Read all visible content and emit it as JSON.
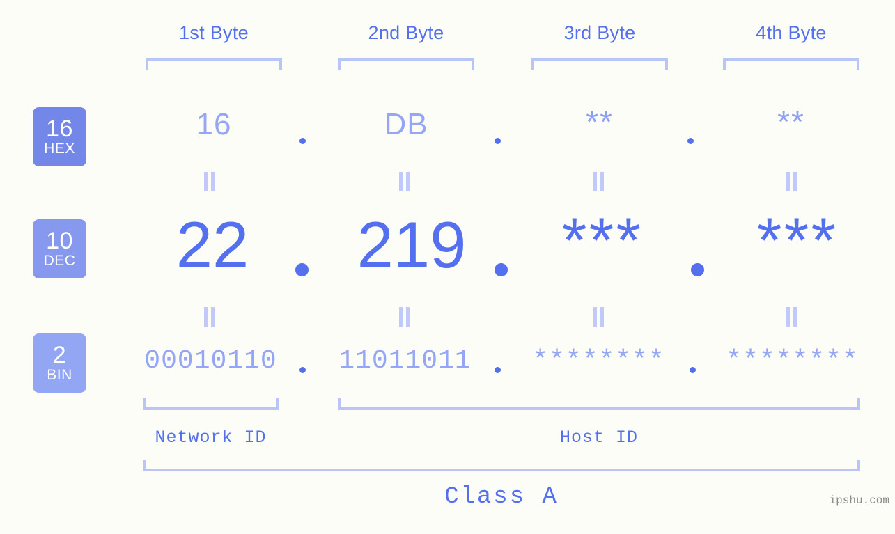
{
  "background_color": "#fbfdf6",
  "colors": {
    "primary_blue": "#5570ee",
    "light_blue": "#94a6f4",
    "bracket_blue": "#b9c4f8",
    "badge_hex": "#7387e9",
    "badge_dec": "#8699ef",
    "badge_bin": "#93a6f4",
    "watermark_gray": "#8b8b8b"
  },
  "headers": {
    "byte1": "1st Byte",
    "byte2": "2nd Byte",
    "byte3": "3rd Byte",
    "byte4": "4th Byte"
  },
  "radix_badges": [
    {
      "num": "16",
      "name": "HEX"
    },
    {
      "num": "10",
      "name": "DEC"
    },
    {
      "num": "2",
      "name": "BIN"
    }
  ],
  "rows": {
    "hex": {
      "radix": "16",
      "label": "HEX",
      "values": [
        "16",
        "DB",
        "**",
        "**"
      ],
      "separators": [
        ".",
        ".",
        "."
      ]
    },
    "dec": {
      "radix": "10",
      "label": "DEC",
      "values": [
        "22",
        "219",
        "***",
        "***"
      ],
      "separators": [
        ".",
        ".",
        "."
      ]
    },
    "bin": {
      "radix": "2",
      "label": "BIN",
      "values": [
        "00010110",
        "11011011",
        "********",
        "********"
      ],
      "separators": [
        ".",
        ".",
        "."
      ]
    }
  },
  "equivalence_mark": "||",
  "footer": {
    "network_id": "Network ID",
    "host_id": "Host ID",
    "class_label": "Class A"
  },
  "watermark": "ipshu.com"
}
